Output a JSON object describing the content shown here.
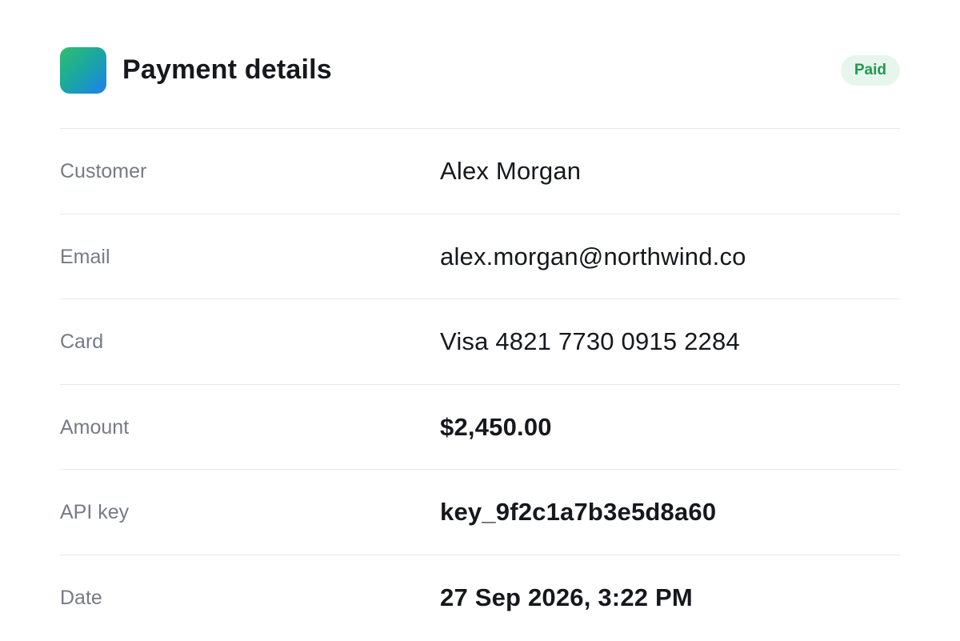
{
  "header": {
    "title": "Payment details",
    "status": "Paid",
    "icon": "app-logo-icon"
  },
  "colors": {
    "status_text": "#1f9a4c",
    "status_bg": "#e6f6ec",
    "label": "#767b85",
    "value": "#16181d",
    "divider": "#e7e8ea"
  },
  "details": [
    {
      "label": "Customer",
      "value": "Alex Morgan"
    },
    {
      "label": "Email",
      "value": "alex.morgan@northwind.co"
    },
    {
      "label": "Card",
      "value": "Visa 4821 7730 0915 2284"
    },
    {
      "label": "Amount",
      "value": "$2,450.00"
    },
    {
      "label": "API key",
      "value": "key_9f2c1a7b3e5d8a60"
    },
    {
      "label": "Date",
      "value": "27 Sep 2026, 3:22 PM"
    }
  ]
}
